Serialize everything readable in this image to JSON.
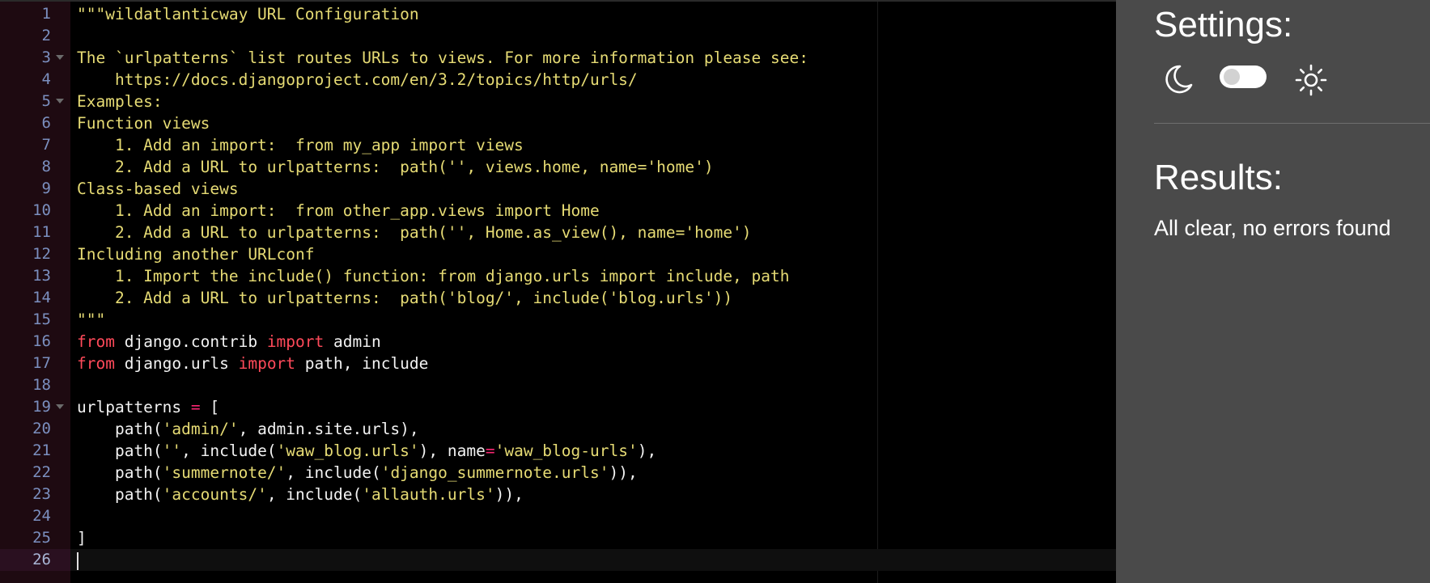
{
  "editor": {
    "lines": [
      {
        "num": "1",
        "fold": false,
        "tokens": [
          {
            "t": "\"\"\"wildatlanticway URL Configuration",
            "c": "str"
          }
        ]
      },
      {
        "num": "2",
        "fold": false,
        "tokens": []
      },
      {
        "num": "3",
        "fold": true,
        "tokens": [
          {
            "t": "The `urlpatterns` list routes URLs to views. For more information please see:",
            "c": "str"
          }
        ]
      },
      {
        "num": "4",
        "fold": false,
        "tokens": [
          {
            "t": "    https://docs.djangoproject.com/en/3.2/topics/http/urls/",
            "c": "str"
          }
        ]
      },
      {
        "num": "5",
        "fold": true,
        "tokens": [
          {
            "t": "Examples:",
            "c": "str"
          }
        ]
      },
      {
        "num": "6",
        "fold": false,
        "tokens": [
          {
            "t": "Function views",
            "c": "str"
          }
        ]
      },
      {
        "num": "7",
        "fold": false,
        "tokens": [
          {
            "t": "    1. Add an import:  from my_app import views",
            "c": "str"
          }
        ]
      },
      {
        "num": "8",
        "fold": false,
        "tokens": [
          {
            "t": "    2. Add a URL to urlpatterns:  path('', views.home, name='home')",
            "c": "str"
          }
        ]
      },
      {
        "num": "9",
        "fold": false,
        "tokens": [
          {
            "t": "Class-based views",
            "c": "str"
          }
        ]
      },
      {
        "num": "10",
        "fold": false,
        "tokens": [
          {
            "t": "    1. Add an import:  from other_app.views import Home",
            "c": "str"
          }
        ]
      },
      {
        "num": "11",
        "fold": false,
        "tokens": [
          {
            "t": "    2. Add a URL to urlpatterns:  path('', Home.as_view(), name='home')",
            "c": "str"
          }
        ]
      },
      {
        "num": "12",
        "fold": false,
        "tokens": [
          {
            "t": "Including another URLconf",
            "c": "str"
          }
        ]
      },
      {
        "num": "13",
        "fold": false,
        "tokens": [
          {
            "t": "    1. Import the include() function: from django.urls import include, path",
            "c": "str"
          }
        ]
      },
      {
        "num": "14",
        "fold": false,
        "tokens": [
          {
            "t": "    2. Add a URL to urlpatterns:  path('blog/', include('blog.urls'))",
            "c": "str"
          }
        ]
      },
      {
        "num": "15",
        "fold": false,
        "tokens": [
          {
            "t": "\"\"\"",
            "c": "str"
          }
        ]
      },
      {
        "num": "16",
        "fold": false,
        "tokens": [
          {
            "t": "from",
            "c": "kw"
          },
          {
            "t": " django.contrib ",
            "c": "txt"
          },
          {
            "t": "import",
            "c": "kw"
          },
          {
            "t": " admin",
            "c": "txt"
          }
        ]
      },
      {
        "num": "17",
        "fold": false,
        "tokens": [
          {
            "t": "from",
            "c": "kw"
          },
          {
            "t": " django.urls ",
            "c": "txt"
          },
          {
            "t": "import",
            "c": "kw"
          },
          {
            "t": " path, include",
            "c": "txt"
          }
        ]
      },
      {
        "num": "18",
        "fold": false,
        "tokens": []
      },
      {
        "num": "19",
        "fold": true,
        "tokens": [
          {
            "t": "urlpatterns ",
            "c": "txt"
          },
          {
            "t": "=",
            "c": "op"
          },
          {
            "t": " [",
            "c": "txt"
          }
        ]
      },
      {
        "num": "20",
        "fold": false,
        "tokens": [
          {
            "t": "    path(",
            "c": "txt"
          },
          {
            "t": "'admin/'",
            "c": "str"
          },
          {
            "t": ", admin.site.urls),",
            "c": "txt"
          }
        ]
      },
      {
        "num": "21",
        "fold": false,
        "tokens": [
          {
            "t": "    path(",
            "c": "txt"
          },
          {
            "t": "''",
            "c": "str"
          },
          {
            "t": ", include(",
            "c": "txt"
          },
          {
            "t": "'waw_blog.urls'",
            "c": "str"
          },
          {
            "t": "), name",
            "c": "txt"
          },
          {
            "t": "=",
            "c": "op"
          },
          {
            "t": "'waw_blog-urls'",
            "c": "str"
          },
          {
            "t": "),",
            "c": "txt"
          }
        ]
      },
      {
        "num": "22",
        "fold": false,
        "tokens": [
          {
            "t": "    path(",
            "c": "txt"
          },
          {
            "t": "'summernote/'",
            "c": "str"
          },
          {
            "t": ", include(",
            "c": "txt"
          },
          {
            "t": "'django_summernote.urls'",
            "c": "str"
          },
          {
            "t": ")),",
            "c": "txt"
          }
        ]
      },
      {
        "num": "23",
        "fold": false,
        "tokens": [
          {
            "t": "    path(",
            "c": "txt"
          },
          {
            "t": "'accounts/'",
            "c": "str"
          },
          {
            "t": ", include(",
            "c": "txt"
          },
          {
            "t": "'allauth.urls'",
            "c": "str"
          },
          {
            "t": ")),",
            "c": "txt"
          }
        ]
      },
      {
        "num": "24",
        "fold": false,
        "tokens": []
      },
      {
        "num": "25",
        "fold": false,
        "tokens": [
          {
            "t": "]",
            "c": "txt"
          }
        ]
      },
      {
        "num": "26",
        "fold": false,
        "active": true,
        "cursor": true,
        "tokens": []
      }
    ]
  },
  "panel": {
    "settings_title": "Settings:",
    "theme_toggle": {
      "dark_icon": "moon-icon",
      "light_icon": "sun-icon",
      "state": "off"
    },
    "results_title": "Results:",
    "results_text": "All clear, no errors found"
  },
  "colors": {
    "editor_bg": "#000000",
    "gutter_bg": "#1e0a11",
    "line_number": "#7b8fbf",
    "string": "#e6db74",
    "keyword": "#ff4a5a",
    "operator": "#f92672",
    "text": "#f2f2f2",
    "panel_bg": "#4a4a4a"
  }
}
